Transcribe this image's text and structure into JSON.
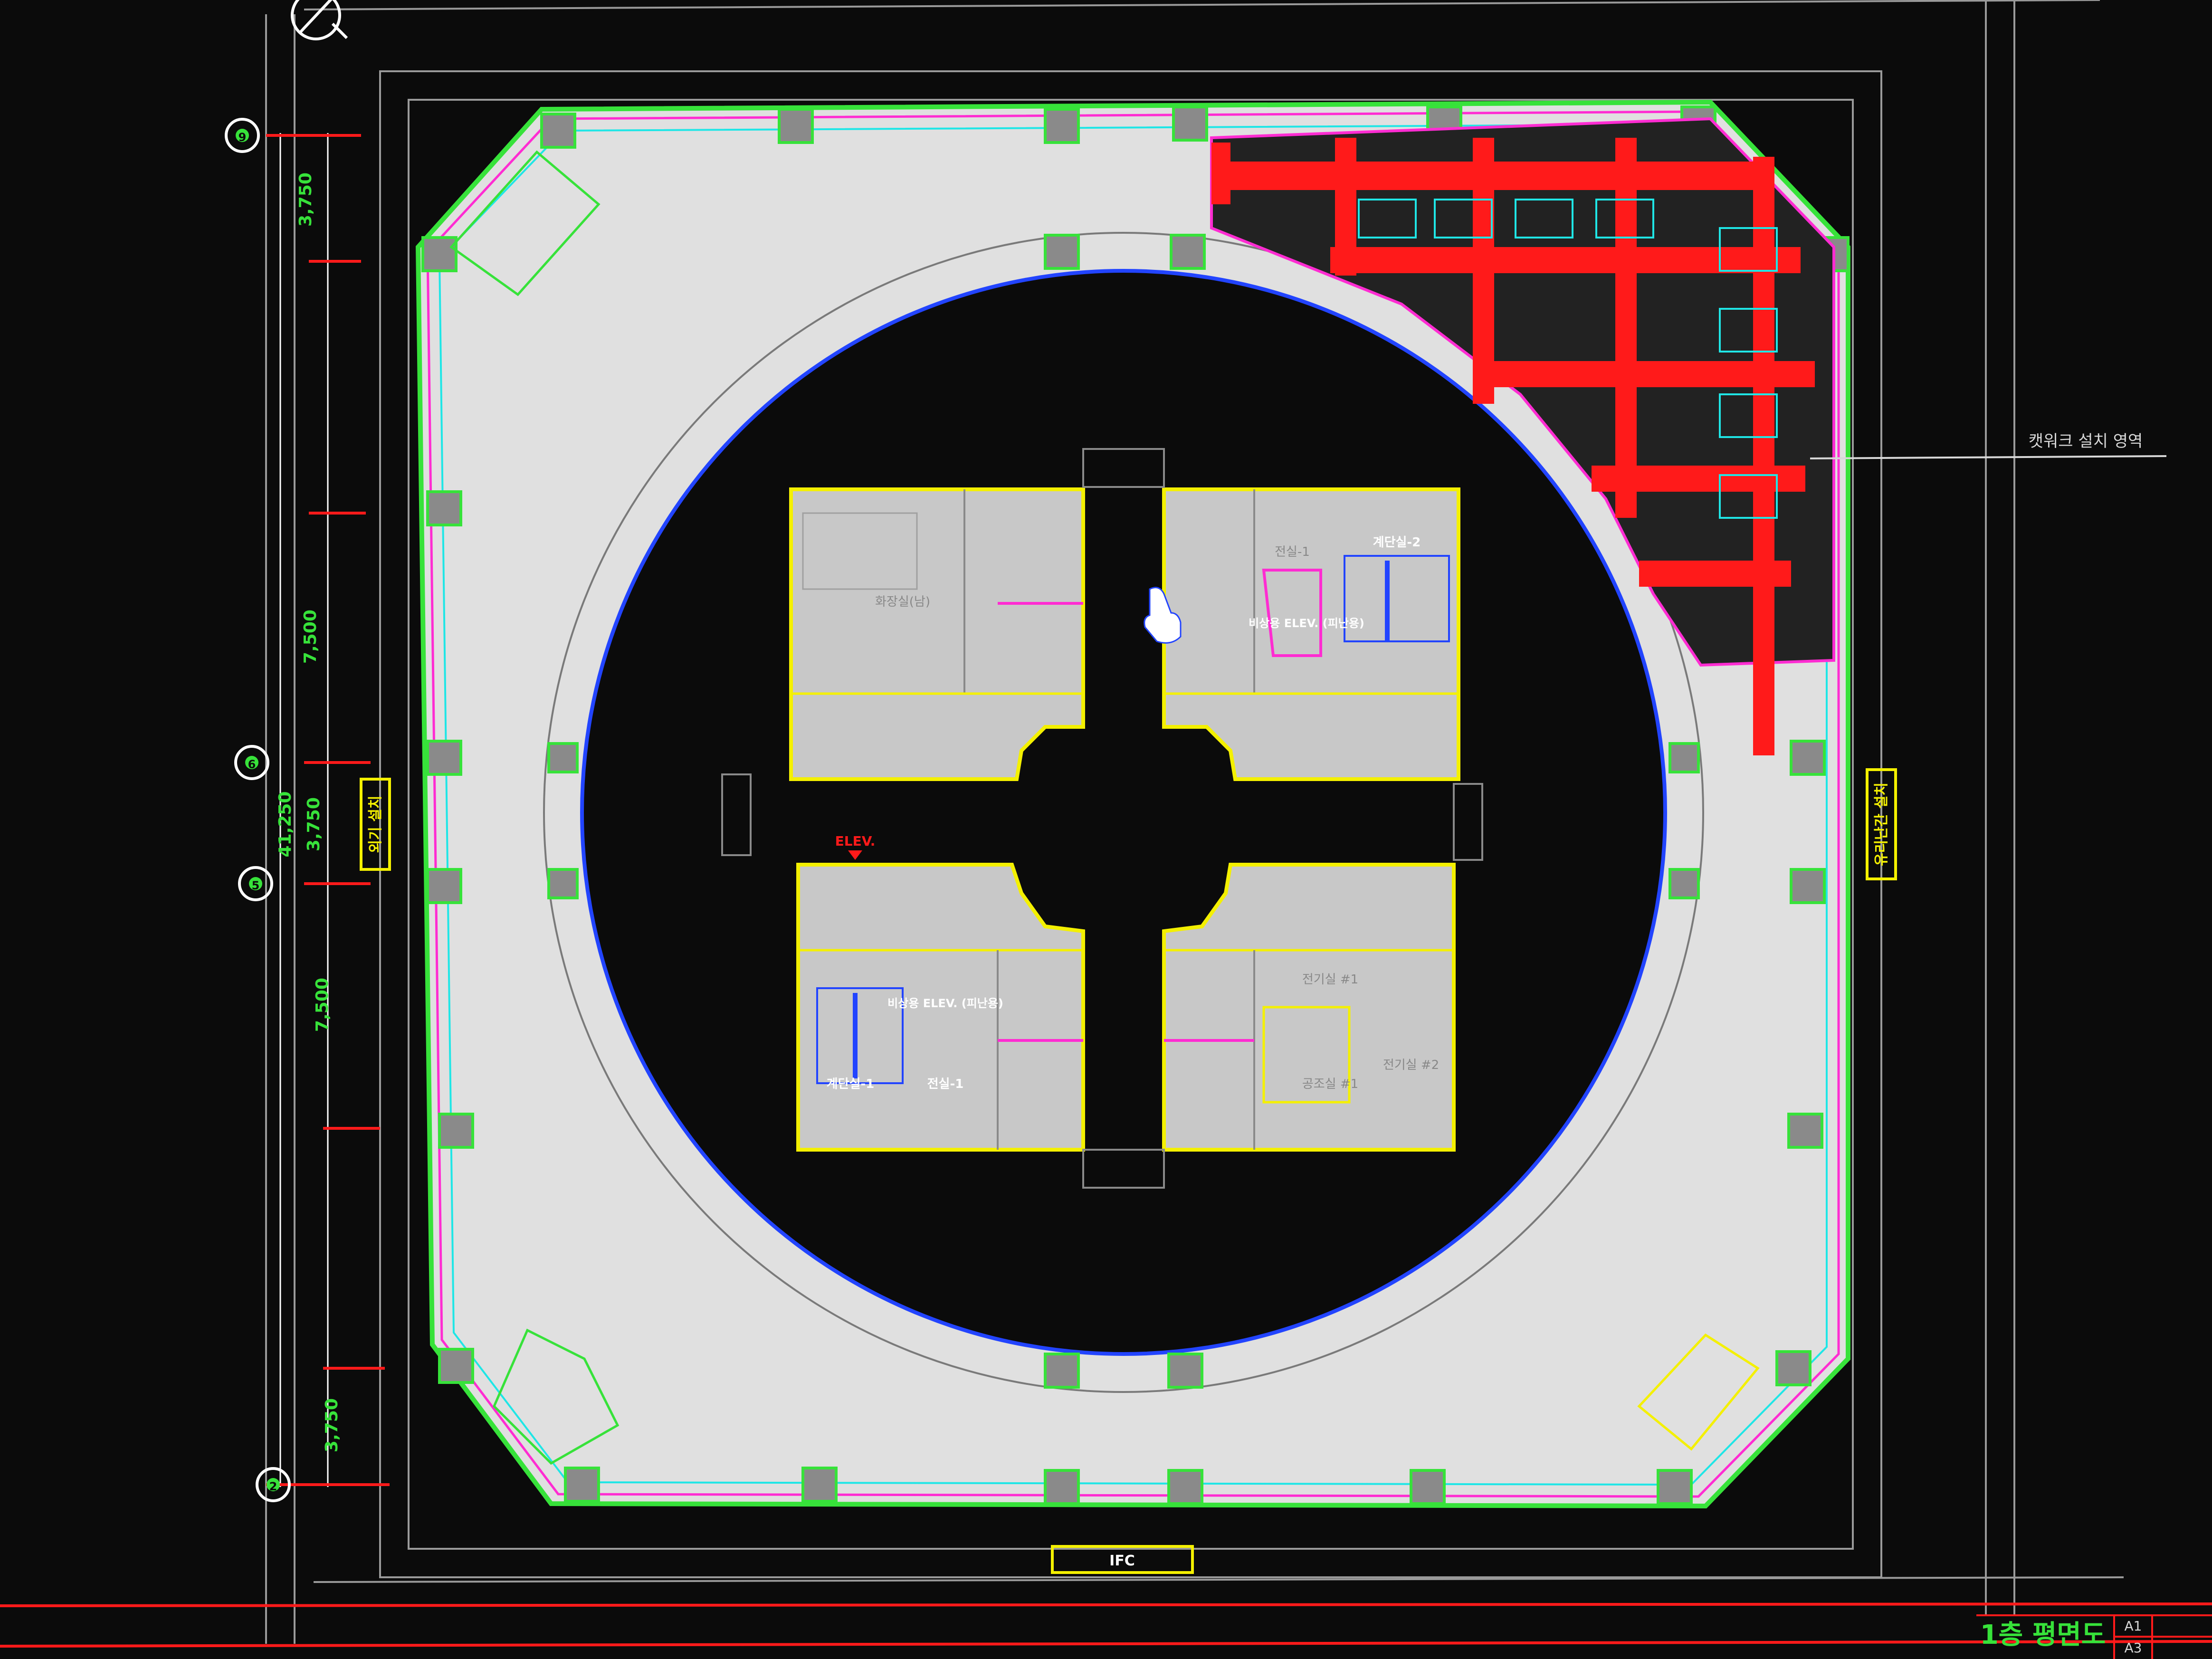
{
  "drawing": {
    "title": "1층 평면도",
    "annotation_label": "캣워크 설치 영역",
    "core_labels": {
      "elev": "ELEV.",
      "ifc_tag": "IFC",
      "nw_room": "화장실(남)",
      "ne_room": "전실-1",
      "ne_stair": "계단실-2",
      "ne_lift": "비상용 ELEV. (피난용)",
      "sw_lift": "비상용 ELEV. (피난용)",
      "sw_stair": "계단실-1",
      "sw_room": "전실-1",
      "se_room_a": "전기실 #1",
      "se_room_b": "전기실 #2",
      "se_room_c": "공조실 #1"
    },
    "dimensions": {
      "dim_top": "3,750",
      "dim_mid1": "7,500",
      "dim_total": "41,250",
      "dim_center": "3,750",
      "dim_mid2": "7,500",
      "dim_bottom": "3,750"
    },
    "grid_bubbles": [
      "9",
      "6",
      "5",
      "2"
    ],
    "side_tags": {
      "left": "외기 설치",
      "right": "유리난간 설치"
    },
    "title_block": {
      "row1": "A1",
      "row2": "A3"
    }
  },
  "colors": {
    "background": "#0b0b0b",
    "floor": "#e0e0e0",
    "core": "#c8c8c8",
    "outline_green": "#37e23a",
    "outline_yellow": "#f4f000",
    "magenta": "#ff2cd2",
    "red": "#ff1a1a",
    "cyan": "#1fe6e6",
    "blue": "#2244ff"
  }
}
